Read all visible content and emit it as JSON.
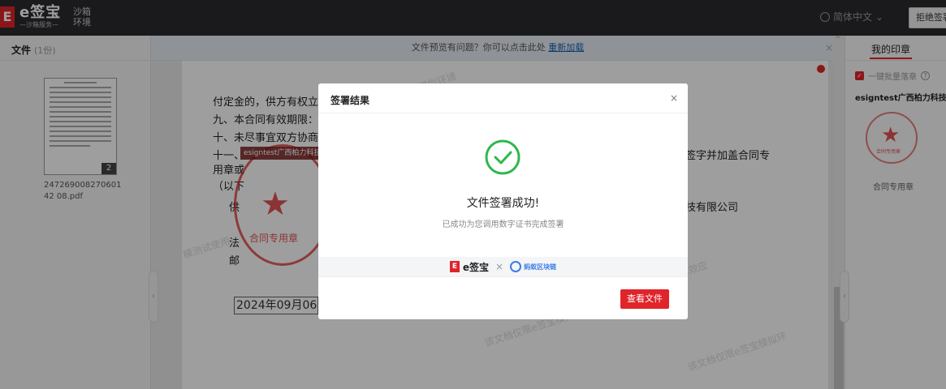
{
  "header": {
    "logo_letter": "E",
    "logo_main": "e签宝",
    "logo_sub": "—沙箱服务—",
    "env_label": "沙箱环境",
    "language": "简体中文",
    "reject_button": "拒绝签署"
  },
  "left_panel": {
    "title": "文件",
    "count": "(1份)",
    "thumbnail_page_badge": "2",
    "file_name": "24726900827060142 08.pdf"
  },
  "notice": {
    "text": "文件预览有问题？你可以点击此处",
    "link": "重新加载"
  },
  "document": {
    "lines": [
      "付定金的，供方有权立即",
      "九、本合同有效期限：",
      "十、未尽事宜双方协商",
      "十一、",
      "用章或",
      "（以下",
      "供",
      "法",
      "邮"
    ],
    "right_text_1": "签字并加盖合同专",
    "right_text_2": "技有限公司",
    "seal_tag": "esigntest广西柏力科技",
    "seal_text": "合同专用章",
    "date_box": "2024年09月06",
    "watermarks": [
      "e签宝模拟环境",
      "法律效应",
      "该文档仅限e签宝模拟环",
      "模测试使用，"
    ]
  },
  "right_panel": {
    "tab": "我的印章",
    "batch_label": "一键批量落章",
    "company": "esigntest广西柏力科技有限",
    "mini_seal_text": "合同专用章",
    "seal_name": "合同专用章"
  },
  "modal": {
    "title": "签署结果",
    "close": "×",
    "success_title": "文件签署成功!",
    "success_sub": "已成功为您调用数字证书完成签署",
    "brand_esign": "e签宝",
    "brand_x": "×",
    "brand_ant": "蚂蚁区块链",
    "view_button": "查看文件"
  },
  "colors": {
    "brand_red": "#e0242a",
    "success_green": "#2db84d",
    "ant_blue": "#3b7ce8"
  }
}
